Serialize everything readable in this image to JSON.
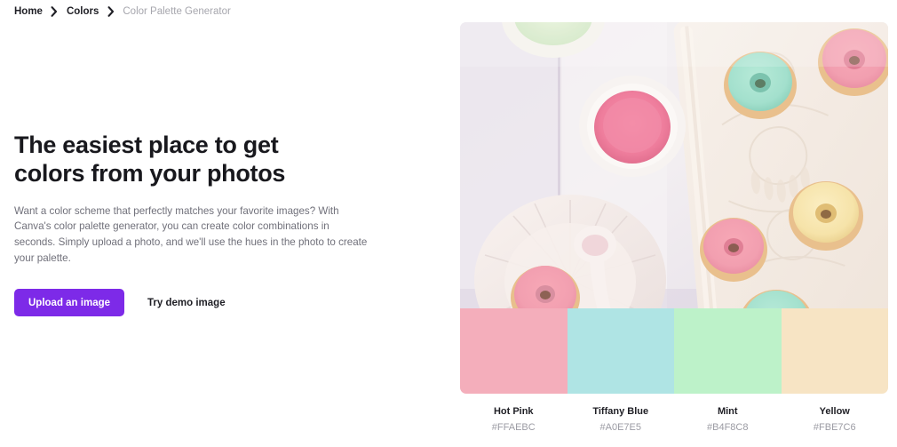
{
  "breadcrumb": {
    "items": [
      {
        "label": "Home",
        "current": false
      },
      {
        "label": "Colors",
        "current": false
      },
      {
        "label": "Color Palette Generator",
        "current": true
      }
    ],
    "separator_icon": "chevron-right-icon"
  },
  "hero": {
    "title": "The easiest place to get colors from your photos",
    "body": "Want a color scheme that perfectly matches your favorite images? With Canva's color palette generator, you can create color combinations in seconds. Simply upload a photo, and we'll use the hues in the photo to create your palette.",
    "primary_button": "Upload an image",
    "secondary_button": "Try demo image",
    "primary_button_color": "#7D2AE8",
    "title_color": "#18181D",
    "body_color": "#70707A"
  },
  "palette": {
    "photo_alt": "Pastel-glazed mini donuts on a white ceramic tray with bowls of pink and green icing",
    "swatches": [
      {
        "name": "Hot Pink",
        "hex": "#FFAEBC",
        "display_color": "#F4AEBB"
      },
      {
        "name": "Tiffany Blue",
        "hex": "#A0E7E5",
        "display_color": "#AFE4E4"
      },
      {
        "name": "Mint",
        "hex": "#B4F8C8",
        "display_color": "#BDF2C9"
      },
      {
        "name": "Yellow",
        "hex": "#FBE7C6",
        "display_color": "#F7E4C4"
      }
    ]
  }
}
